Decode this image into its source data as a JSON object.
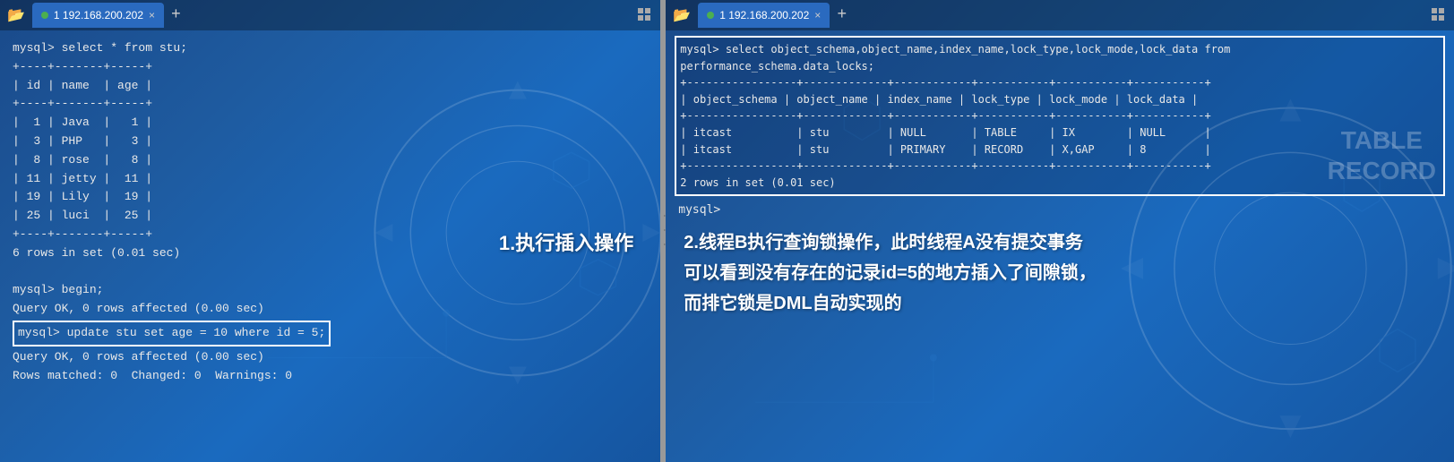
{
  "left_panel": {
    "tab": {
      "dot_color": "#4caf50",
      "label": "1 192.168.200.202",
      "close": "×",
      "add": "+"
    },
    "terminal_lines": [
      "mysql> select * from stu;",
      "+----+-------+-----+",
      "| id | name  | age |",
      "+----+-------+-----+",
      "|  1 | Java  |   1 |",
      "|  3 | PHP   |   3 |",
      "|  8 | rose  |   8 |",
      "| 11 | jetty |  11 |",
      "| 19 | Lily  |  19 |",
      "| 25 | luci  |  25 |",
      "+----+-------+-----+",
      "6 rows in set (0.01 sec)",
      "",
      "mysql> begin;",
      "Query OK, 0 rows affected (0.00 sec)",
      "",
      "mysql> update stu set age = 10 where id = 5;",
      "Query OK, 0 rows affected (0.00 sec)",
      "Rows matched: 0  Changed: 0  Warnings: 0"
    ],
    "highlight_line": "mysql> update stu set age = 10 where id = 5;",
    "annotation": "1.执行插入操作"
  },
  "right_panel": {
    "tab": {
      "dot_color": "#4caf50",
      "label": "1 192.168.200.202",
      "close": "×",
      "add": "+"
    },
    "query_lines": [
      "mysql> select object_schema,object_name,index_name,lock_type,lock_mode,lock_data from",
      "performance_schema.data_locks;",
      "+-----------------+-------------+------------+-----------+-----------+-----------+",
      "| object_schema | object_name | index_name | lock_type | lock_mode | lock_data |",
      "+-----------------+-------------+------------+-----------+-----------+-----------+",
      "| itcast          | stu         | NULL       | TABLE     | IX        | NULL      |",
      "| itcast          | stu         | PRIMARY    | RECORD    | X,GAP     | 8         |",
      "+-----------------+-------------+------------+-----------+-----------+-----------+",
      "2 rows in set (0.01 sec)"
    ],
    "prompt_line": "mysql>",
    "annotation_line1": "2.线程B执行查询锁操作，此时线程A没有提交事务",
    "annotation_line2": "可以看到没有存在的记录id=5的地方插入了间隙锁，",
    "annotation_line3": "而排它锁是DML自动实现的",
    "table_record_label": "TABLE\nRECORD"
  },
  "divider": "||"
}
